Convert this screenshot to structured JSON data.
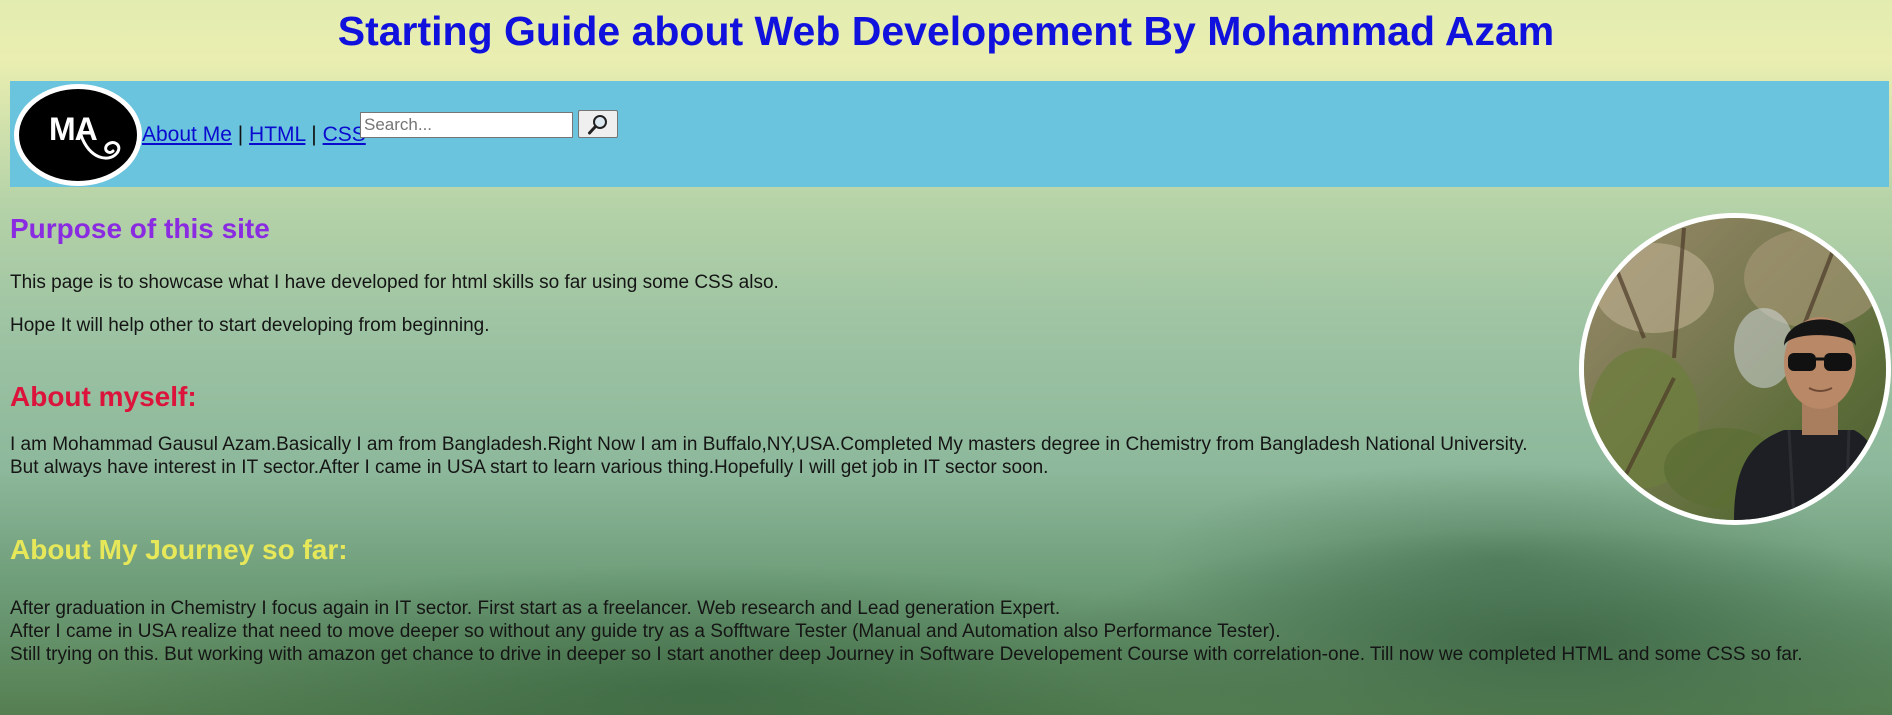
{
  "header": {
    "title": "Starting Guide about Web Developement By Mohammad Azam"
  },
  "nav": {
    "logo": {
      "text": "MA",
      "icon": "logo-icon"
    },
    "links": [
      {
        "label": "About Me"
      },
      {
        "label": "HTML"
      },
      {
        "label": "CSS"
      }
    ],
    "separator": "|",
    "search": {
      "value": "",
      "placeholder": "Search...",
      "button_icon": "magnifier-icon"
    },
    "background_color": "#6ac4de"
  },
  "profile": {
    "photo_icon": "profile-photo"
  },
  "sections": {
    "purpose": {
      "heading": "Purpose of this site",
      "heading_color": "#8a2be2",
      "paragraphs": [
        "This page is to showcase what I have developed for html skills so far using some CSS also.",
        "Hope It will help other to start developing from beginning."
      ]
    },
    "about": {
      "heading": "About myself:",
      "heading_color": "#dc143c",
      "lines": [
        "I am Mohammad Gausul Azam.Basically I am from Bangladesh.Right Now I am in Buffalo,NY,USA.Completed My masters degree in Chemistry from Bangladesh National University.",
        "But always have interest in IT sector.After I came in USA start to learn various thing.Hopefully I will get job in IT sector soon."
      ]
    },
    "journey": {
      "heading": "About My Journey so far:",
      "heading_color": "#e6e85a",
      "lines": [
        "After graduation in Chemistry I focus again in IT sector. First start as a freelancer. Web research and Lead generation Expert.",
        "After I came in USA realize that need to move deeper so without any guide try as a Sofftware Tester (Manual and Automation also Performance Tester).",
        "Still trying on this. But working with amazon get chance to drive in deeper so I start another deep Journey in Software Developement Course with correlation-one. Till now we completed HTML and some CSS so far."
      ]
    }
  }
}
